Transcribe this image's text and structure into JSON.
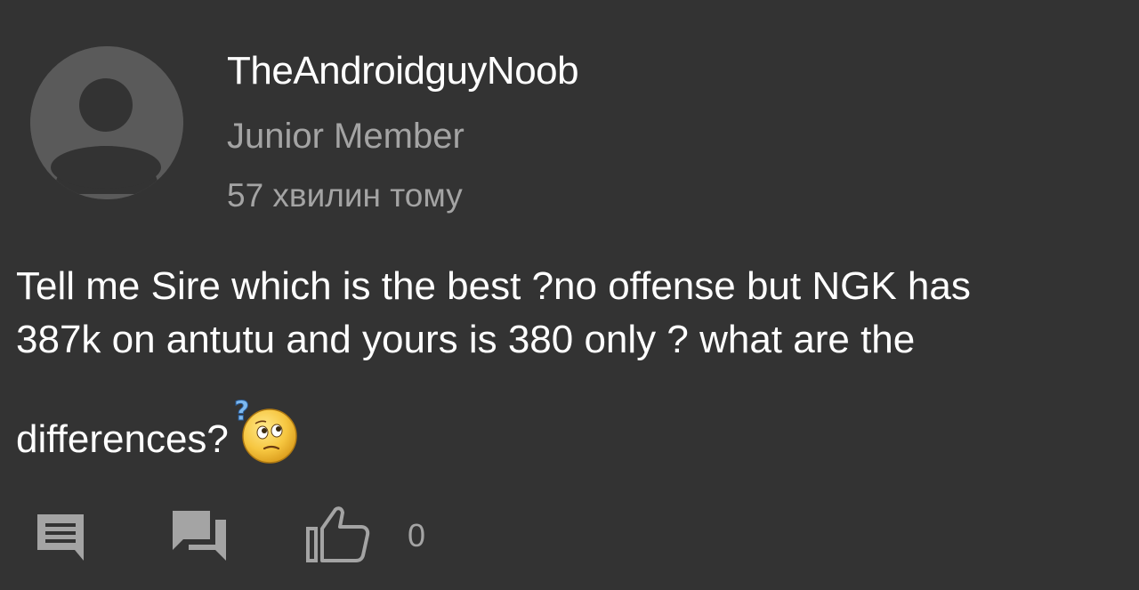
{
  "comment": {
    "author": {
      "name": "TheAndroidguyNoob",
      "rank": "Junior Member",
      "avatar_icon": "default-user-avatar-icon"
    },
    "time_ago": "57 хвилин тому",
    "text_lines": [
      "Tell me Sire which is the best ?no offense but NGK has",
      "387k on antutu and yours is 380 only ? what are the",
      "differences?"
    ],
    "emoji": "thinking-confused-emoji-icon"
  },
  "actions": {
    "reply_icon": "reply-icon",
    "chat_icon": "chat-icon",
    "like_icon": "thumbs-up-icon",
    "like_count": "0"
  },
  "colors": {
    "background": "#333333",
    "primary_text": "#ffffff",
    "secondary_text": "#a4a4a4",
    "avatar_bg": "#5a5a5a",
    "avatar_fg": "#333333",
    "icon": "#a4a4a4"
  }
}
